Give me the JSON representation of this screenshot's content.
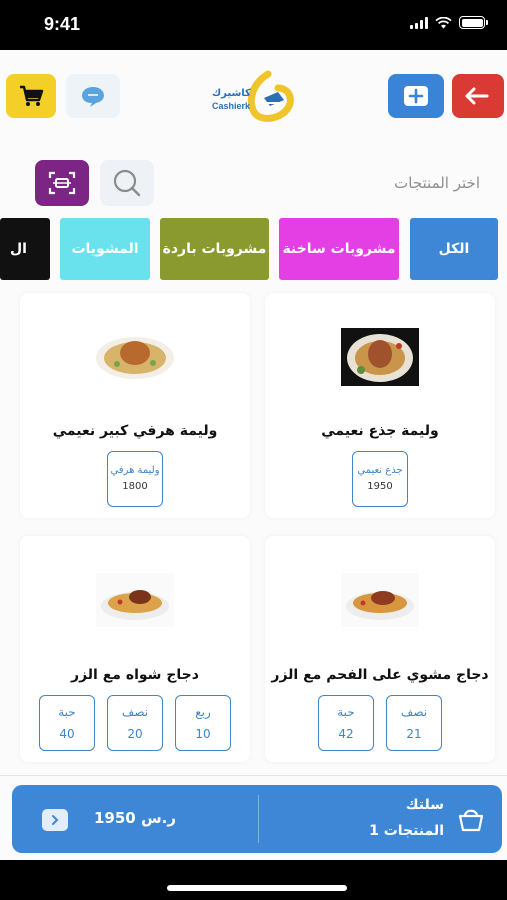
{
  "status": {
    "time": "9:41"
  },
  "header": {
    "logo_ar": "كاشيرك",
    "logo_en": "Cashierk"
  },
  "products_section": {
    "label": "اختر المنتجات"
  },
  "categories": [
    {
      "label": "الكل"
    },
    {
      "label": "مشروبات ساخنة"
    },
    {
      "label": "مشروبات باردة"
    },
    {
      "label": "المشويات"
    },
    {
      "label": "ال"
    }
  ],
  "products": [
    {
      "name": "وليمة جذع نعيمي",
      "options": [
        {
          "name": "جذع نعيمي",
          "price": "1950"
        }
      ]
    },
    {
      "name": "وليمة هرفي كبير نعيمي",
      "options": [
        {
          "name": "وليمة هرفي",
          "price": "1800"
        }
      ]
    },
    {
      "name": "دجاج مشوي على الفحم مع الزر",
      "options": [
        {
          "name": "حبة",
          "price": "42"
        },
        {
          "name": "نصف",
          "price": "21"
        }
      ]
    },
    {
      "name": "دجاج شواه مع الزر",
      "options": [
        {
          "name": "حبة",
          "price": "40"
        },
        {
          "name": "نصف",
          "price": "20"
        },
        {
          "name": "ربع",
          "price": "10"
        }
      ]
    }
  ],
  "basket": {
    "title": "سلتك",
    "count_label": "1 المنتجات",
    "total": "1950 ر.س"
  },
  "colors": {
    "primary": "#3d87d6",
    "logout": "#d93a34",
    "cart": "#f3cf28",
    "scan": "#7d2585"
  }
}
